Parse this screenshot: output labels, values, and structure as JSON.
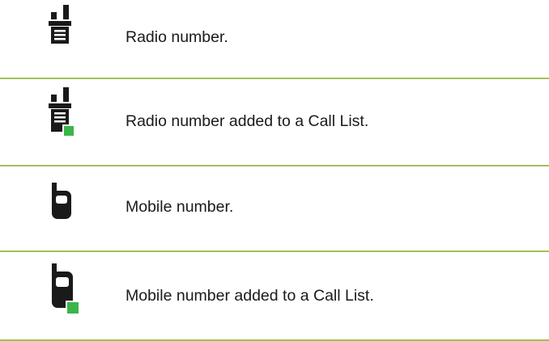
{
  "legend": {
    "rows": [
      {
        "icon": "radio-icon",
        "description": "Radio number."
      },
      {
        "icon": "radio-call-list-icon",
        "description": "Radio number added to a Call List."
      },
      {
        "icon": "mobile-icon",
        "description": "Mobile number."
      },
      {
        "icon": "mobile-call-list-icon",
        "description": "Mobile number added to a Call List."
      }
    ]
  },
  "colors": {
    "divider": "#a3c05a",
    "icon": "#1a1a1a",
    "call_list_badge": "#3ab54a"
  }
}
